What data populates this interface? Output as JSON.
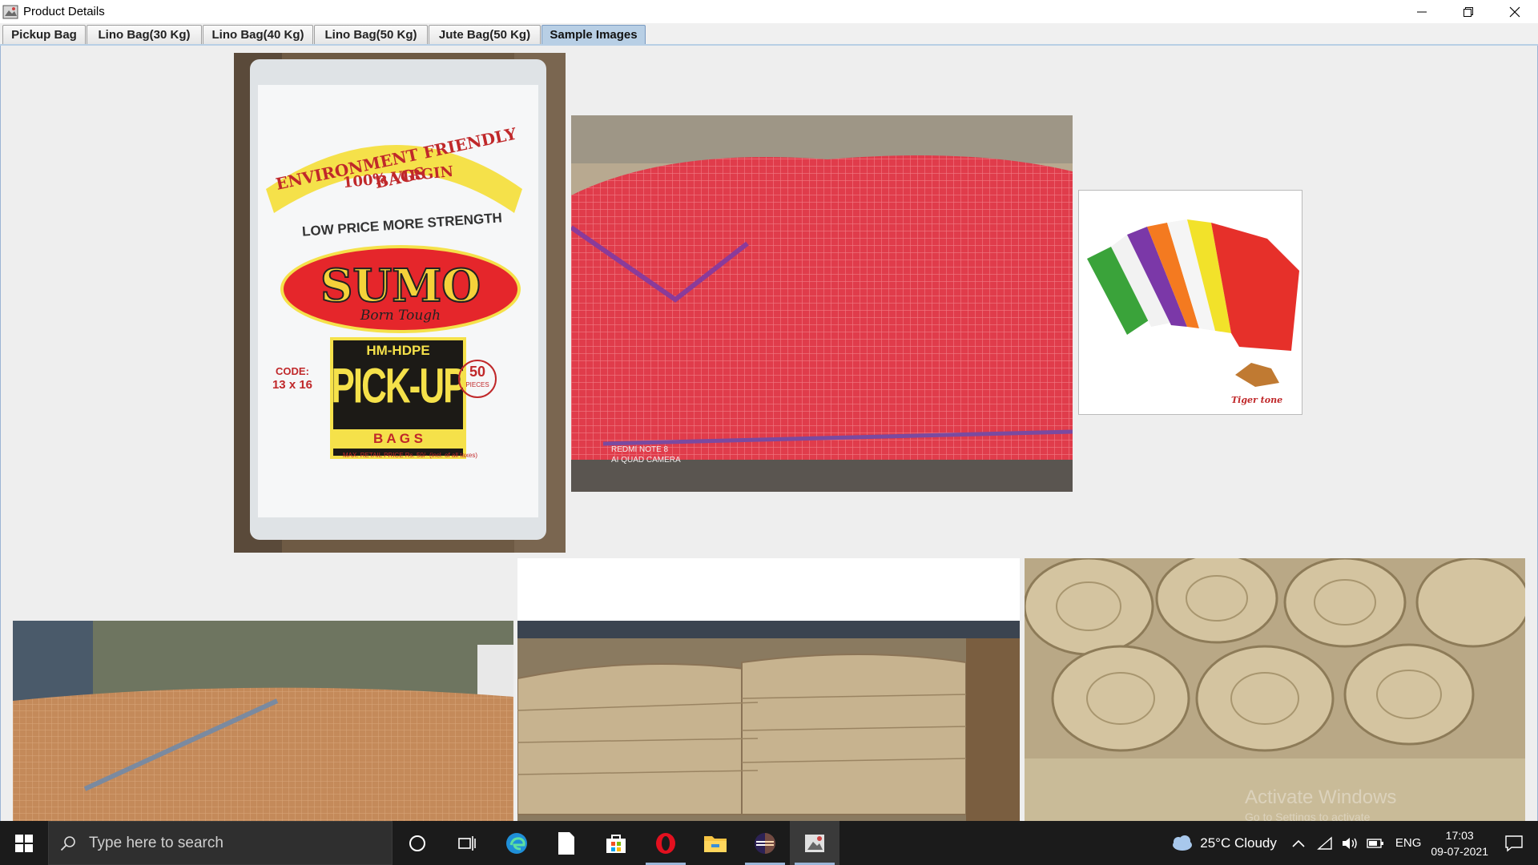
{
  "window": {
    "title": "Product Details"
  },
  "tabs": [
    {
      "label": "Pickup Bag",
      "active": false
    },
    {
      "label": "Lino Bag(30 Kg)",
      "active": false
    },
    {
      "label": "Lino Bag(40 Kg)",
      "active": false
    },
    {
      "label": "Lino Bag(50 Kg)",
      "active": false
    },
    {
      "label": "Jute Bag(50 Kg)",
      "active": false
    },
    {
      "label": "Sample Images",
      "active": true
    }
  ],
  "images": {
    "pickup": {
      "line1": "ENVIRONMENT FRIENDLY BAGS",
      "line2": "100% VIRGIN",
      "line3": "LOW PRICE MORE STRENGTH",
      "brand": "SUMO",
      "tagline": "Born Tough",
      "material": "HM-HDPE",
      "product": "PICK-UP",
      "sub": "B A G S",
      "code_label": "CODE:",
      "code": "13 x 16",
      "pieces": "50",
      "pieces_label": "PIECES",
      "mrp": "MAX. RETAIL PRICE Rs. 50/- (incl. of all taxes)"
    },
    "red_mesh": {
      "watermark1": "REDMI NOTE 8",
      "watermark2": "AI QUAD CAMERA"
    },
    "colored_mesh": {
      "brand": "Tiger tone"
    },
    "jute_rolls": {
      "overlay1": "Activate Windows",
      "overlay2": "Go to Settings to activate"
    }
  },
  "taskbar": {
    "search_placeholder": "Type here to search",
    "weather": "25°C  Cloudy",
    "language": "ENG",
    "time": "17:03",
    "date": "09-07-2021"
  },
  "colors": {
    "tab_active": "#b8cfe5",
    "taskbar": "#1b1b1b"
  }
}
